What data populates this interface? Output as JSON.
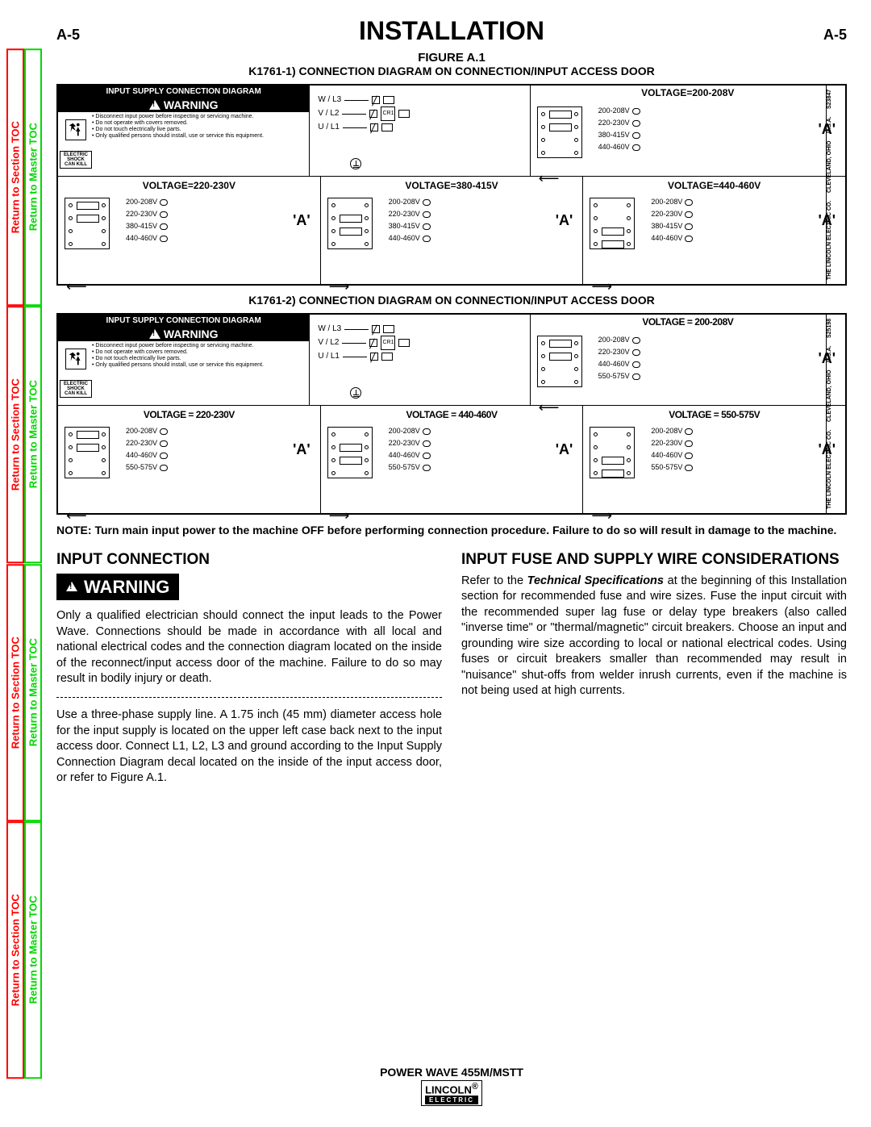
{
  "page": {
    "number_left": "A-5",
    "number_right": "A-5",
    "title": "INSTALLATION"
  },
  "side_tabs": {
    "section": "Return to Section TOC",
    "master": "Return to Master TOC"
  },
  "figure": {
    "title": "FIGURE A.1",
    "sub1": "K1761-1) CONNECTION DIAGRAM ON CONNECTION/INPUT ACCESS DOOR",
    "sub2": "K1761-2) CONNECTION DIAGRAM ON CONNECTION/INPUT ACCESS DOOR"
  },
  "diagram_common": {
    "header": "INPUT SUPPLY CONNECTION DIAGRAM",
    "warning": "WARNING",
    "shock_label": "ELECTRIC SHOCK CAN KILL",
    "bullets": [
      "Disconnect input power before inspecting or servicing machine.",
      "Do not operate with covers removed.",
      "Do not touch electrically live parts.",
      "Only qualified persons should install, use or service this equipment."
    ],
    "wires": {
      "l3": "W / L3",
      "l2": "V / L2",
      "l1": "U / L1",
      "cr1": "CR1"
    },
    "a_mark": "'A'"
  },
  "diagram1": {
    "top_volt_title": "VOLTAGE=200-208V",
    "top_volts": [
      "200-208V",
      "220-230V",
      "380-415V",
      "440-460V"
    ],
    "cells": [
      {
        "title": "VOLTAGE=220-230V",
        "volts": [
          "200-208V",
          "220-230V",
          "380-415V",
          "440-460V"
        ]
      },
      {
        "title": "VOLTAGE=380-415V",
        "volts": [
          "200-208V",
          "220-230V",
          "380-415V",
          "440-460V"
        ]
      },
      {
        "title": "VOLTAGE=440-460V",
        "volts": [
          "200-208V",
          "220-230V",
          "380-415V",
          "440-460V"
        ]
      }
    ],
    "side": [
      "THE LINCOLN ELECTRIC CO.",
      "CLEVELAND, OHIO",
      "U.S.A.",
      "S23847"
    ]
  },
  "diagram2": {
    "top_volt_title": "VOLTAGE = 200-208V",
    "top_volts": [
      "200-208V",
      "220-230V",
      "440-460V",
      "550-575V"
    ],
    "cells": [
      {
        "title": "VOLTAGE = 220-230V",
        "volts": [
          "200-208V",
          "220-230V",
          "440-460V",
          "550-575V"
        ]
      },
      {
        "title": "VOLTAGE = 440-460V",
        "volts": [
          "200-208V",
          "220-230V",
          "440-460V",
          "550-575V"
        ]
      },
      {
        "title": "VOLTAGE = 550-575V",
        "volts": [
          "200-208V",
          "220-230V",
          "440-460V",
          "550-575V"
        ]
      }
    ],
    "side": [
      "THE LINCOLN ELECTRIC CO.",
      "CLEVELAND, OHIO",
      "U.S.A.",
      "S25198"
    ]
  },
  "note": "NOTE: Turn main input power to the machine OFF before performing connection procedure. Failure to do so will result in damage to the machine.",
  "left_col": {
    "heading": "INPUT CONNECTION",
    "warning": "WARNING",
    "p1": "Only a qualified electrician should connect the input leads to the Power Wave. Connections should be made in accordance with all local and national electrical codes and the connection diagram located on the inside of the reconnect/input access door of the machine. Failure to do so may result in bodily injury or death.",
    "p2": "Use a three-phase supply line. A 1.75 inch (45 mm) diameter access hole for the input supply is located on the upper left case back next to the input access door. Connect L1, L2, L3 and ground according to the Input Supply Connection Diagram decal located on the inside of the input access door, or refer to Figure A.1."
  },
  "right_col": {
    "heading": "INPUT FUSE AND SUPPLY WIRE CONSIDERATIONS",
    "p1_a": "Refer to the ",
    "p1_em": "Technical Specifications",
    "p1_b": " at the beginning of this Installation section for recommended fuse and wire sizes.  Fuse the input circuit with the recommended super lag fuse or delay type breakers (also called \"inverse time\" or \"thermal/magnetic\" circuit breakers.  Choose an input and grounding wire size according to local or national electrical codes.  Using fuses or circuit breakers smaller than recommended may result in \"nuisance\" shut-offs from welder inrush currents, even if the machine is not being used at high currents."
  },
  "footer": {
    "model": "POWER WAVE 455M/MSTT",
    "brand": "LINCOLN",
    "brand_sub": "ELECTRIC",
    "reg": "®"
  }
}
